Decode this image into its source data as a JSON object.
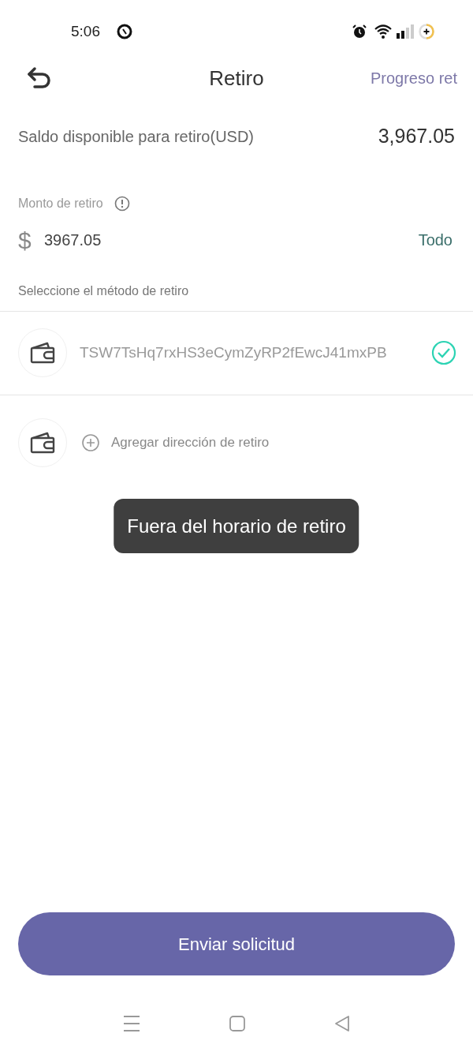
{
  "status_bar": {
    "time": "5:06"
  },
  "header": {
    "title": "Retiro",
    "link": "Progreso ret"
  },
  "balance": {
    "label": "Saldo disponible para retiro(USD)",
    "value": "3,967.05"
  },
  "amount": {
    "label": "Monto de retiro",
    "currency": "$",
    "value": "3967.05",
    "all_link": "Todo"
  },
  "methods_label": "Seleccione el método de retiro",
  "methods": [
    {
      "kind": "address",
      "address": "TSW7TsHq7rxHS3eCymZyRP2fEwcJ41mxPB",
      "selected": true
    },
    {
      "kind": "add",
      "label": "Agregar dirección de retiro"
    }
  ],
  "toast": "Fuera del horario de retiro",
  "submit": "Enviar solicitud"
}
